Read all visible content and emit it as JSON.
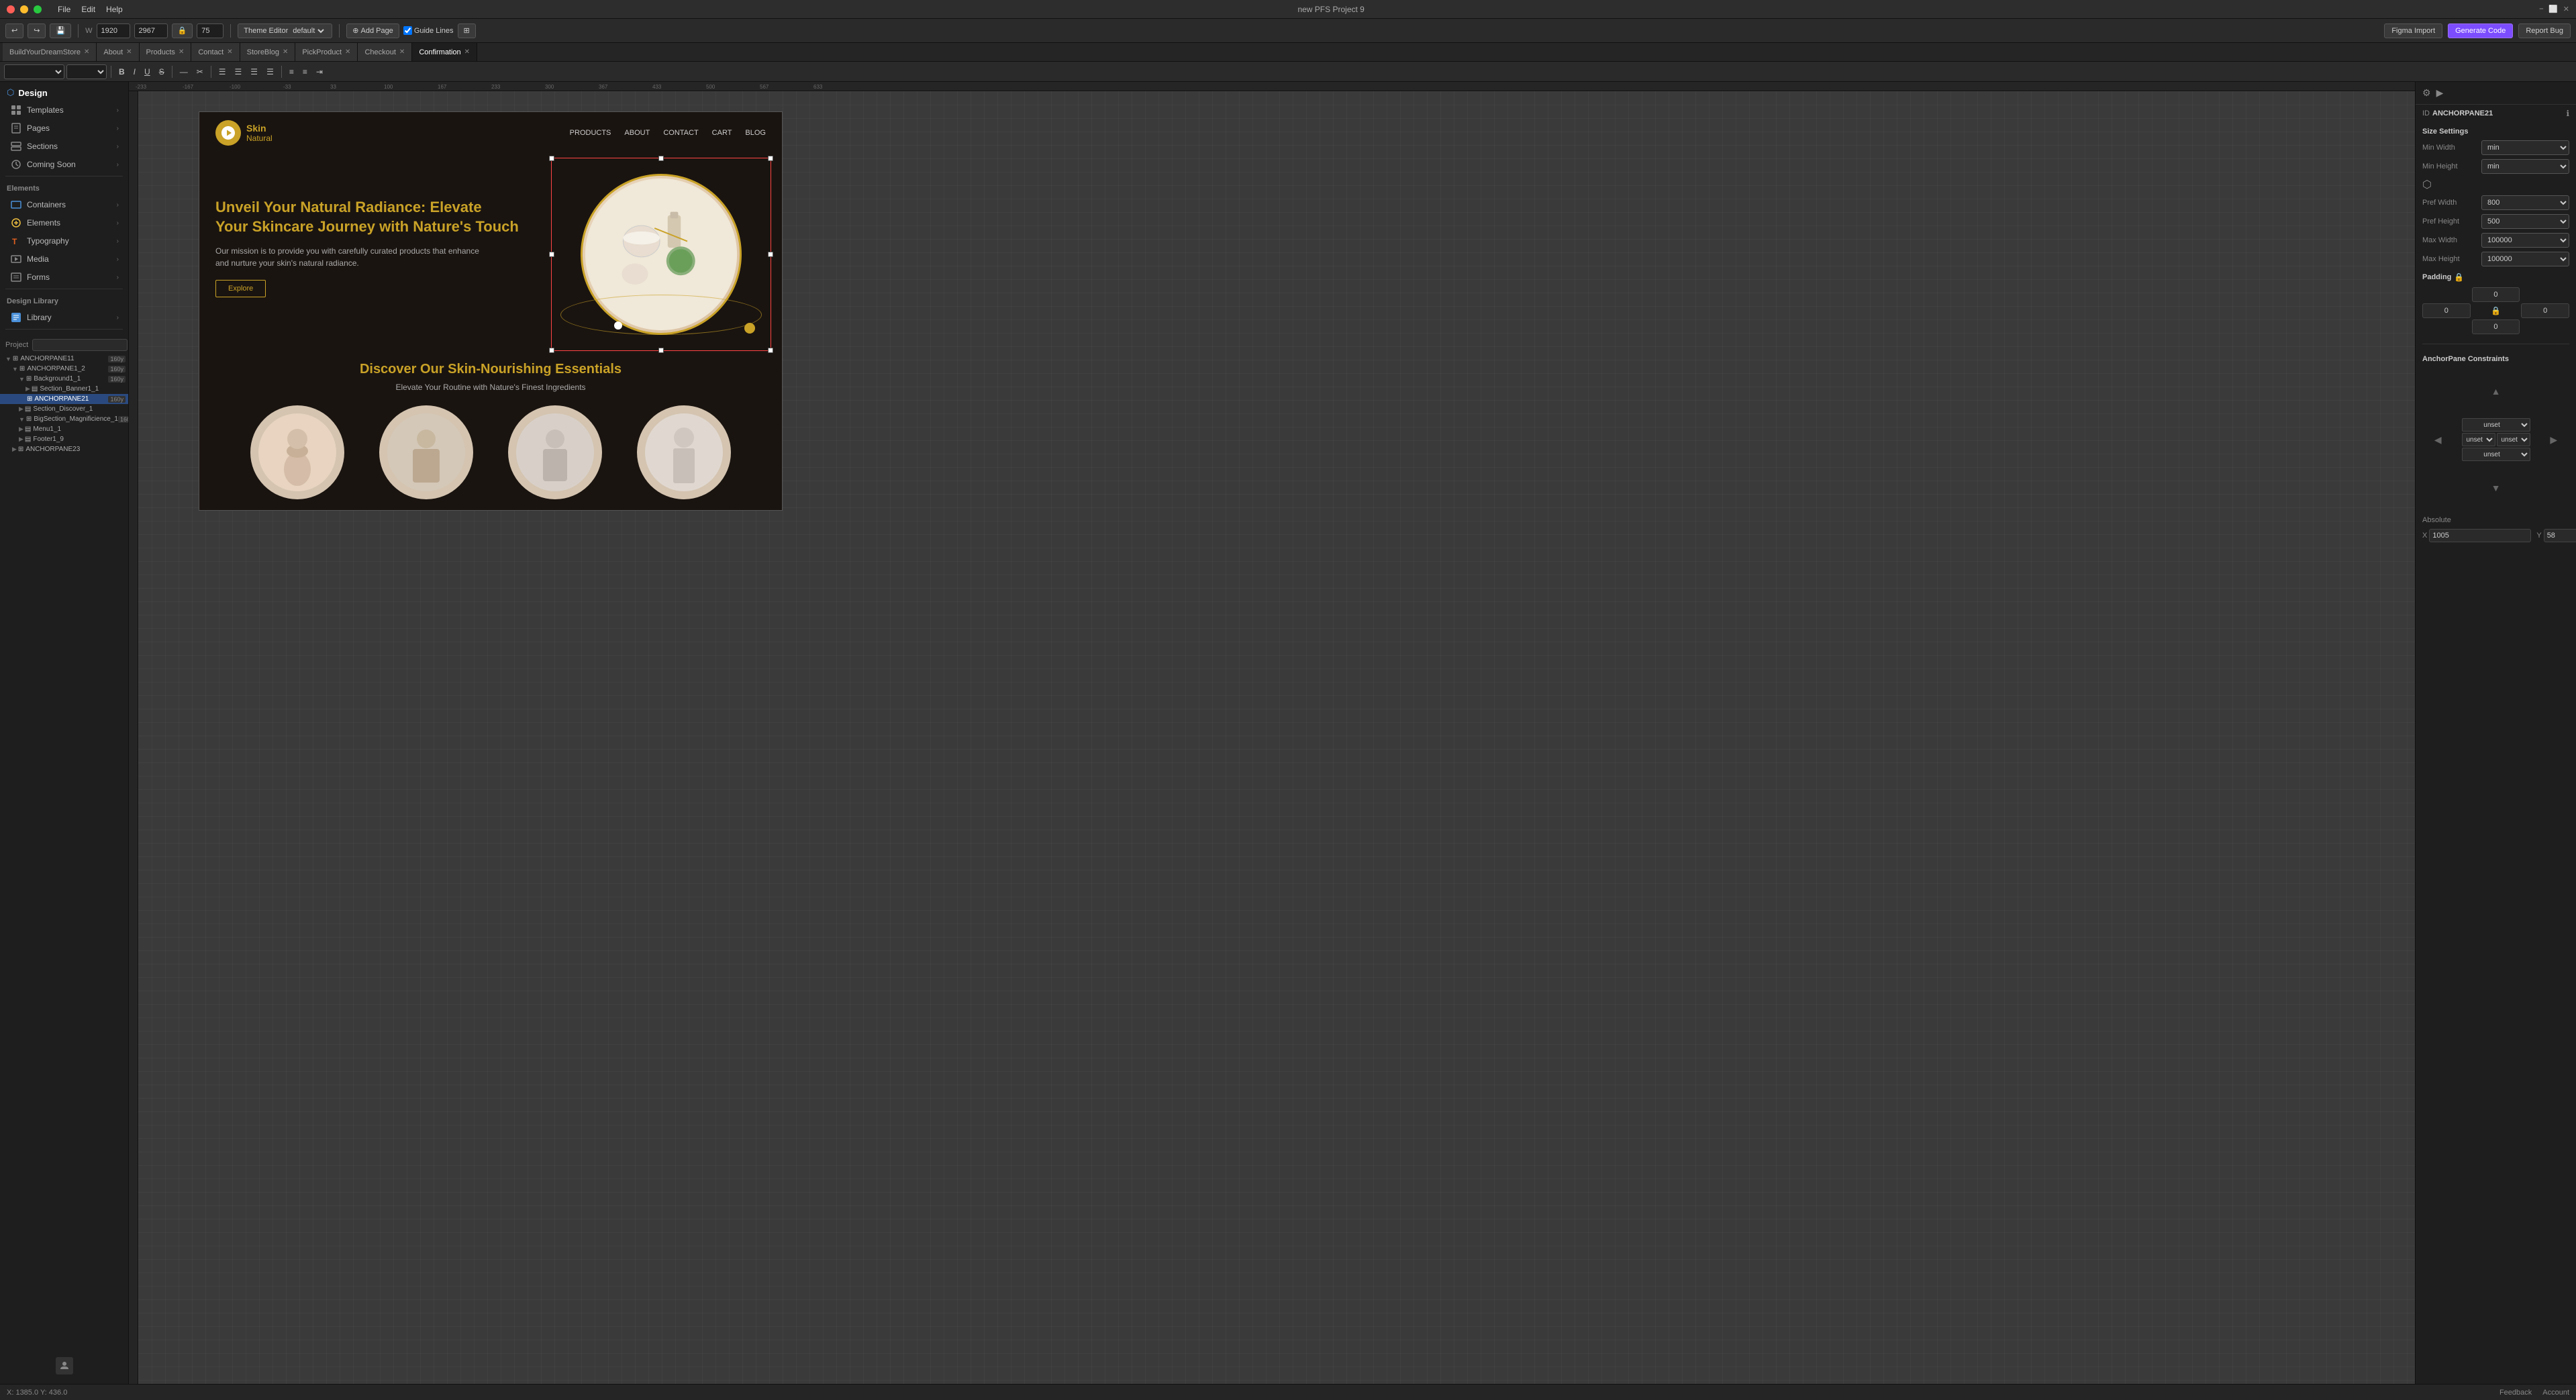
{
  "titlebar": {
    "title": "new PFS Project 9",
    "menu": [
      "File",
      "Edit",
      "Help"
    ],
    "buttons": {
      "close": "×",
      "minimize": "−",
      "maximize": "□"
    }
  },
  "toolbar": {
    "undo": "↩",
    "redo": "↪",
    "width_label": "W",
    "width_value": "1920",
    "height_value": "2967",
    "zoom_value": "75",
    "theme_editor": "Theme Editor",
    "theme_default": "default",
    "add_page": "Add Page",
    "guide_lines": "Guide Lines",
    "grid_icon": "⊞",
    "figma_import": "Figma Import",
    "generate_code": "Generate Code",
    "report_bug": "Report Bug"
  },
  "tabs": [
    {
      "id": "tab1",
      "label": "BuildYourDreamStore",
      "closable": true
    },
    {
      "id": "tab2",
      "label": "About",
      "closable": true
    },
    {
      "id": "tab3",
      "label": "Products",
      "closable": true
    },
    {
      "id": "tab4",
      "label": "Contact",
      "closable": true
    },
    {
      "id": "tab5",
      "label": "StoreBlog",
      "closable": true
    },
    {
      "id": "tab6",
      "label": "PickProduct",
      "closable": true
    },
    {
      "id": "tab7",
      "label": "Checkout",
      "closable": true
    },
    {
      "id": "tab8",
      "label": "Confirmation",
      "closable": true,
      "active": true
    }
  ],
  "format_toolbar": {
    "font_family": "",
    "font_size": "",
    "bold": "B",
    "italic": "I",
    "underline": "U",
    "strikethrough": "S",
    "dash": "—",
    "cut": "✂",
    "align_left": "≡",
    "align_center": "≡",
    "align_right": "≡",
    "align_justify": "≡",
    "bullet_list": "≡",
    "numbered_list": "≡",
    "indent": "⇥"
  },
  "left_sidebar": {
    "design_label": "Design",
    "templates_label": "Templates",
    "pages_label": "Pages",
    "sections_label": "Sections",
    "coming_soon_label": "Coming Soon",
    "elements_label": "Elements",
    "containers_label": "Containers",
    "elements_sub_label": "Elements",
    "typography_label": "Typography",
    "media_label": "Media",
    "forms_label": "Forms",
    "design_library_label": "Design Library",
    "library_label": "Library"
  },
  "project_tree": {
    "label": "Project",
    "items": [
      {
        "id": "anchor11",
        "label": "ANCHORPANE11",
        "level": 0,
        "expanded": true
      },
      {
        "id": "anchor12",
        "label": "ANCHORPANE1_2",
        "level": 1,
        "expanded": true
      },
      {
        "id": "bg1",
        "label": "Background1_1",
        "level": 2,
        "expanded": true
      },
      {
        "id": "sec_banner",
        "label": "Section_Banner1_1",
        "level": 3
      },
      {
        "id": "anchor21",
        "label": "ANCHORPANE21",
        "level": 3,
        "selected": true
      },
      {
        "id": "sec_discover",
        "label": "Section_Discover_1",
        "level": 2
      },
      {
        "id": "big_section",
        "label": "BigSection_Magnificience_1",
        "level": 2,
        "expanded": true
      },
      {
        "id": "menu1",
        "label": "Menu1_1",
        "level": 2
      },
      {
        "id": "footer1",
        "label": "Footer1_9",
        "level": 2
      },
      {
        "id": "anchor23",
        "label": "ANCHORPANE23",
        "level": 1
      }
    ]
  },
  "preview": {
    "nav": {
      "logo_name": "Skin",
      "logo_sub": "Natural",
      "links": [
        "PRODUCTS",
        "ABOUT",
        "CONTACT",
        "CART",
        "BLOG"
      ]
    },
    "hero": {
      "title": "Unveil Your Natural Radiance: Elevate\nYour Skincare Journey with Nature's Touch",
      "description": "Our mission is to provide you with carefully curated products that enhance\nand nurture your skin's natural radiance.",
      "cta": "Explore"
    },
    "discover": {
      "title": "Discover Our Skin-Nourishing Essentials",
      "subtitle": "Elevate Your Routine with Nature's Finest Ingredients"
    }
  },
  "right_panel": {
    "id_label": "ID",
    "id_value": "ANCHORPANE21",
    "size_settings": "Size Settings",
    "min_width_label": "Min Width",
    "min_width_value": "min",
    "min_height_label": "Min Height",
    "min_height_value": "min",
    "pref_width_label": "Pref Width",
    "pref_width_value": "800",
    "pref_height_label": "Pref Height",
    "pref_height_value": "500",
    "max_width_label": "Max Width",
    "max_width_value": "100000",
    "max_height_label": "Max Height",
    "max_height_value": "100000",
    "padding_label": "Padding",
    "pad_top": "0",
    "pad_left": "0",
    "pad_right": "0",
    "pad_bottom": "0",
    "constraints_label": "AnchorPane Constraints",
    "constraint_top": "unset",
    "constraint_bottom": "unset",
    "constraint_left": "unset",
    "constraint_right": "unset",
    "absolute_label": "Absolute",
    "abs_x_label": "X",
    "abs_x_value": "1005",
    "abs_y_label": "Y",
    "abs_y_value": "58"
  },
  "status_bar": {
    "coords": "X: 1385.0 Y: 436.0",
    "feedback": "Feedback",
    "account": "Account"
  }
}
